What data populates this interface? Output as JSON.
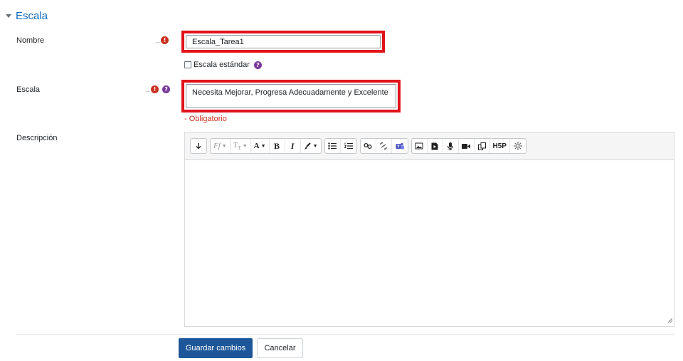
{
  "section": {
    "title": "Escala"
  },
  "nombre": {
    "label": "Nombre",
    "value": "Escala_Tarea1"
  },
  "estandar": {
    "label": "Escala estándar"
  },
  "escala": {
    "label": "Escala",
    "value": "Necesita Mejorar, Progresa Adecuadamente y Excelente",
    "error": "- Obligatorio"
  },
  "descripcion": {
    "label": "Descripción"
  },
  "toolbar": {
    "groups": [
      [
        "collapse-toggle-icon"
      ],
      [
        "font-family-icon",
        "font-size-icon",
        "text-color-icon",
        "bold-icon",
        "italic-icon",
        "highlight-icon"
      ],
      [
        "unordered-list-icon",
        "ordered-list-icon"
      ],
      [
        "link-icon",
        "unlink-icon",
        "teams-icon"
      ],
      [
        "image-icon",
        "media-icon",
        "record-audio-icon",
        "record-video-icon",
        "copy-icon",
        "h5p-icon",
        "accessibility-icon"
      ]
    ]
  },
  "buttons": {
    "save": "Guardar cambios",
    "cancel": "Cancelar"
  },
  "colors": {
    "accent": "#0f6cbf",
    "required": "#ca3120",
    "help": "#7a3a9a",
    "highlight_box": "#e0131b",
    "save_bg": "#1e5799"
  }
}
